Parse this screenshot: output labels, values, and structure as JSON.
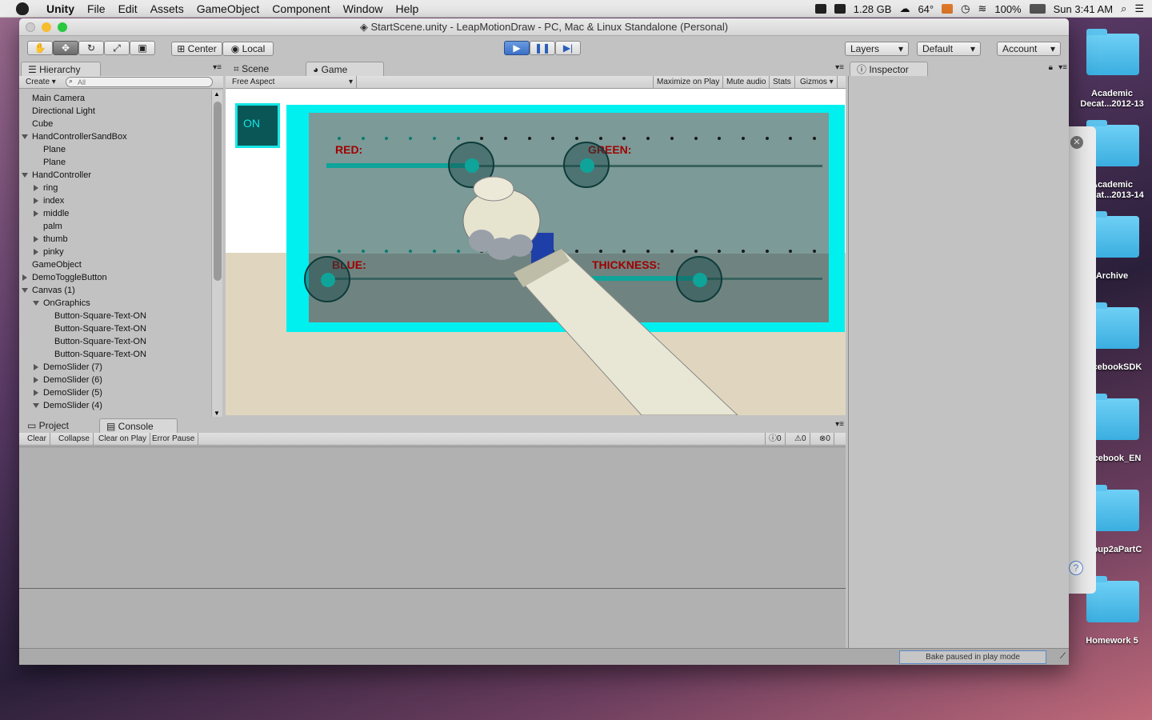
{
  "menubar": {
    "app": "Unity",
    "items": [
      "File",
      "Edit",
      "Assets",
      "GameObject",
      "Component",
      "Window",
      "Help"
    ],
    "memory": "1.28 GB",
    "temp": "64°",
    "battery": "100%",
    "clock": "Sun 3:41 AM"
  },
  "window": {
    "title": "StartScene.unity - LeapMotionDraw - PC, Mac & Linux Standalone (Personal)"
  },
  "toolbar": {
    "center": "Center",
    "local": "Local",
    "layers": "Layers",
    "layout": "Default",
    "account": "Account"
  },
  "hierarchy": {
    "tab": "Hierarchy",
    "create": "Create",
    "search_placeholder": "All",
    "rows": [
      {
        "label": "Main Camera",
        "indent": 0,
        "arrow": ""
      },
      {
        "label": "Directional Light",
        "indent": 0,
        "arrow": ""
      },
      {
        "label": "Cube",
        "indent": 0,
        "arrow": ""
      },
      {
        "label": "HandControllerSandBox",
        "indent": 0,
        "arrow": "open"
      },
      {
        "label": "Plane",
        "indent": 1,
        "arrow": ""
      },
      {
        "label": "Plane",
        "indent": 1,
        "arrow": ""
      },
      {
        "label": "HandController",
        "indent": 0,
        "arrow": "open"
      },
      {
        "label": "ring",
        "indent": 1,
        "arrow": "closed"
      },
      {
        "label": "index",
        "indent": 1,
        "arrow": "closed"
      },
      {
        "label": "middle",
        "indent": 1,
        "arrow": "closed"
      },
      {
        "label": "palm",
        "indent": 1,
        "arrow": ""
      },
      {
        "label": "thumb",
        "indent": 1,
        "arrow": "closed"
      },
      {
        "label": "pinky",
        "indent": 1,
        "arrow": "closed"
      },
      {
        "label": "GameObject",
        "indent": 0,
        "arrow": ""
      },
      {
        "label": "DemoToggleButton",
        "indent": 0,
        "arrow": "closed"
      },
      {
        "label": "Canvas (1)",
        "indent": 0,
        "arrow": "open"
      },
      {
        "label": "OnGraphics",
        "indent": 1,
        "arrow": "open"
      },
      {
        "label": "Button-Square-Text-ON",
        "indent": 2,
        "arrow": ""
      },
      {
        "label": "Button-Square-Text-ON",
        "indent": 2,
        "arrow": ""
      },
      {
        "label": "Button-Square-Text-ON",
        "indent": 2,
        "arrow": ""
      },
      {
        "label": "Button-Square-Text-ON",
        "indent": 2,
        "arrow": ""
      },
      {
        "label": "DemoSlider (7)",
        "indent": 1,
        "arrow": "closed"
      },
      {
        "label": "DemoSlider (6)",
        "indent": 1,
        "arrow": "closed"
      },
      {
        "label": "DemoSlider (5)",
        "indent": 1,
        "arrow": "closed"
      },
      {
        "label": "DemoSlider (4)",
        "indent": 1,
        "arrow": "open"
      }
    ]
  },
  "scene_tabs": {
    "scene": "Scene",
    "game": "Game",
    "aspect": "Free Aspect",
    "maximize": "Maximize on Play",
    "mute": "Mute audio",
    "stats": "Stats",
    "gizmos": "Gizmos"
  },
  "game": {
    "toggle_label": "ON",
    "red": "RED:",
    "green": "GREEN:",
    "blue": "BLUE:",
    "thickness": "THICKNESS:",
    "red_value": 0.28,
    "green_value": 0.5,
    "blue_value": 0.02,
    "thickness_value": 0.5
  },
  "console": {
    "project_tab": "Project",
    "console_tab": "Console",
    "clear": "Clear",
    "collapse": "Collapse",
    "clear_on_play": "Clear on Play",
    "error_pause": "Error Pause",
    "info_count": "0",
    "warn_count": "0",
    "error_count": "0"
  },
  "inspector": {
    "tab": "Inspector"
  },
  "status": {
    "bake": "Bake paused in play mode"
  },
  "desktop": {
    "folders": [
      "Academic Decat...2012-13",
      "Academic Decat...2013-14",
      "Archive",
      "FacebookSDK",
      "Facebook_EN",
      "Group2aPartC",
      "Homework 5"
    ]
  }
}
